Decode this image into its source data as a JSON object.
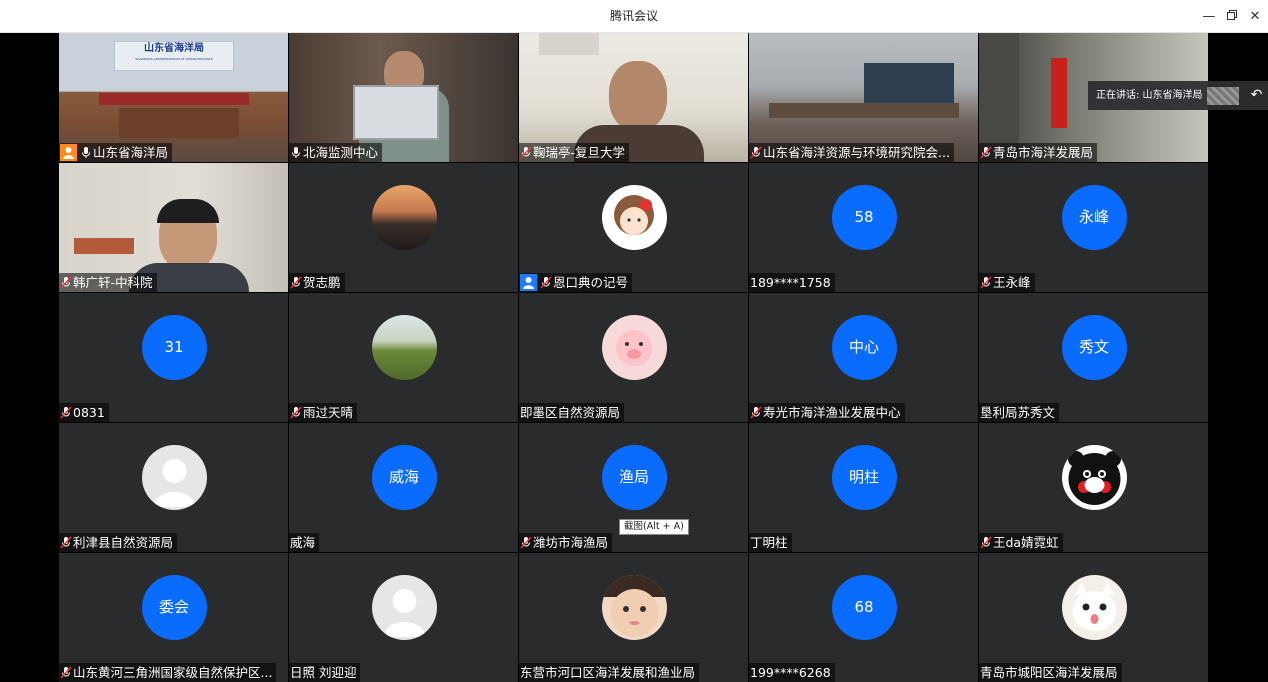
{
  "window": {
    "title": "腾讯会议"
  },
  "speaking_bar": {
    "label": "正在讲话: 山东省海洋局"
  },
  "tooltip": {
    "text": "截图(Alt + A)"
  },
  "video_texts": {
    "banner": "山东省海洋局",
    "banner_sub": "SHANDONG ADMINISTRATION OF OCEAN PROVINCE"
  },
  "colors": {
    "avatar_blue": "#0a6cff",
    "tile_bg": "#2a2b2d",
    "speaking_border": "#2db36b",
    "host_badge": "#ff8a1e"
  },
  "tiles": [
    {
      "name": "山东省海洋局"
    },
    {
      "name": "北海监测中心"
    },
    {
      "name": "鞠瑞亭-复旦大学"
    },
    {
      "name": "山东省海洋资源与环境研究院会..."
    },
    {
      "name": "青岛市海洋发展局"
    },
    {
      "name": "韩广轩-中科院"
    },
    {
      "name": "贺志鹏"
    },
    {
      "name": "恩口典の记号"
    },
    {
      "name": "189****1758",
      "avatar_text": "58"
    },
    {
      "name": "王永峰",
      "avatar_text": "永峰"
    },
    {
      "name": "0831",
      "avatar_text": "31"
    },
    {
      "name": "雨过天晴"
    },
    {
      "name": "即墨区自然资源局"
    },
    {
      "name": "寿光市海洋渔业发展中心",
      "avatar_text": "中心"
    },
    {
      "name": "垦利局苏秀文",
      "avatar_text": "秀文"
    },
    {
      "name": "利津县自然资源局"
    },
    {
      "name": "威海",
      "avatar_text": "威海"
    },
    {
      "name": "潍坊市海渔局",
      "avatar_text": "渔局"
    },
    {
      "name": "丁明柱",
      "avatar_text": "明柱"
    },
    {
      "name": "王da婧霓虹"
    },
    {
      "name": "山东黄河三角洲国家级自然保护区...",
      "avatar_text": "委会"
    },
    {
      "name": "日照 刘迎迎"
    },
    {
      "name": "东营市河口区海洋发展和渔业局"
    },
    {
      "name": "199****6268",
      "avatar_text": "68"
    },
    {
      "name": "青岛市城阳区海洋发展局"
    }
  ]
}
